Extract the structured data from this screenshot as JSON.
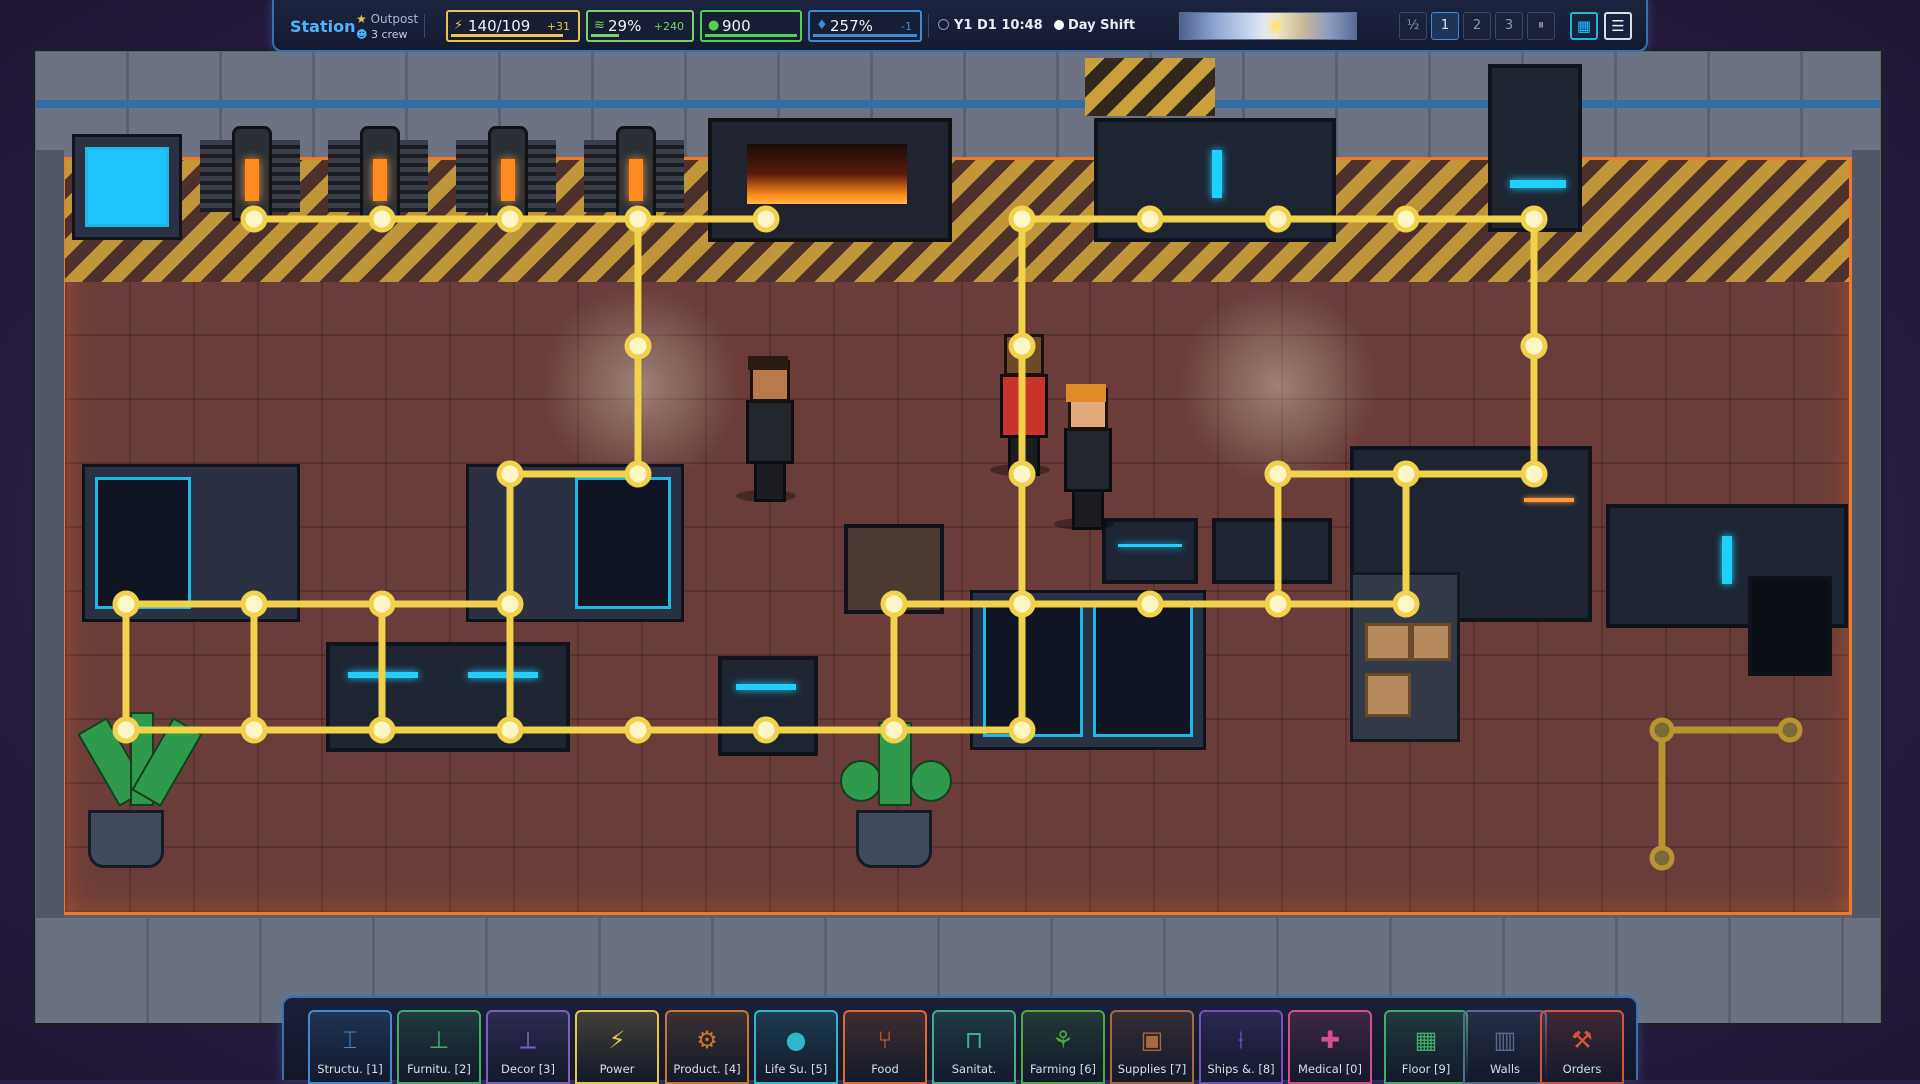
{
  "topbar": {
    "station_label": "Station",
    "outpost_label": "Outpost",
    "crew_label": "3 crew",
    "resources": {
      "power": {
        "value": "140/109",
        "delta": "+31",
        "color": "#e8c547",
        "icon": "lightning-icon",
        "level": 0.9
      },
      "air": {
        "value": "29%",
        "delta": "+240",
        "color": "#7ad26a",
        "icon": "air-icon",
        "level": 0.29
      },
      "food": {
        "value": "900",
        "delta": "",
        "color": "#4fd24f",
        "icon": "apple-icon",
        "level": 1.0
      },
      "water": {
        "value": "257%",
        "delta": "-1",
        "color": "#3f8bd6",
        "icon": "water-drop-icon",
        "level": 1.0
      }
    },
    "date_time": "Y1 D1 10:48",
    "shift": "Day Shift",
    "speeds": [
      "½",
      "1",
      "2",
      "3",
      "⏸"
    ],
    "active_speed": "1",
    "calendar_icon": "calendar-icon",
    "menu_icon": "menu-icon"
  },
  "build_menu": [
    {
      "label": "Structu. [1]",
      "icon": "structure-icon",
      "color": "#3f8bd6",
      "glyph": "⌶"
    },
    {
      "label": "Furnitu. [2]",
      "icon": "furniture-icon",
      "color": "#3fae6a",
      "glyph": "⊥"
    },
    {
      "label": "Decor [3]",
      "icon": "decor-icon",
      "color": "#7a5fc0",
      "glyph": "⟂"
    },
    {
      "label": "Power",
      "icon": "power-icon",
      "color": "#e8c547",
      "glyph": "⚡"
    },
    {
      "label": "Product. [4]",
      "icon": "production-icon",
      "color": "#c8772e",
      "glyph": "⚙"
    },
    {
      "label": "Life Su. [5]",
      "icon": "life-support-icon",
      "color": "#2fb6c8",
      "glyph": "●"
    },
    {
      "label": "Food",
      "icon": "food-icon",
      "color": "#e06a2e",
      "glyph": "⑂"
    },
    {
      "label": "Sanitat.",
      "icon": "sanitation-icon",
      "color": "#3fae8a",
      "glyph": "⊓"
    },
    {
      "label": "Farming [6]",
      "icon": "farming-icon",
      "color": "#4caa3f",
      "glyph": "⚘"
    },
    {
      "label": "Supplies [7]",
      "icon": "supplies-icon",
      "color": "#a86a3a",
      "glyph": "▣"
    },
    {
      "label": "Ships &. [8]",
      "icon": "ships-icon",
      "color": "#7a4fc0",
      "glyph": "⟊"
    },
    {
      "label": "Medical [0]",
      "icon": "medical-icon",
      "color": "#d64f8a",
      "glyph": "✚"
    },
    {
      "label": "Floor [9]",
      "icon": "floor-icon",
      "color": "#3fae6a",
      "glyph": "▦"
    },
    {
      "label": "Walls",
      "icon": "walls-icon",
      "color": "#5a6b8f",
      "glyph": "▥"
    },
    {
      "label": "Orders",
      "icon": "orders-icon",
      "color": "#d6553a",
      "glyph": "⚒"
    }
  ],
  "colors": {
    "wire": "#f2d24a",
    "wire_dim": "#b8952e",
    "accent": "#49b6ff",
    "floor_border": "#f07a25"
  }
}
